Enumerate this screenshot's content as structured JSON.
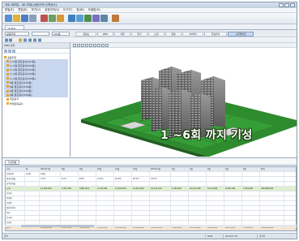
{
  "window": {
    "title": "지트 제작업 - 3D 모델 [공동주택 신축공사]"
  },
  "menu": [
    "파일(F)",
    "편집(E)",
    "보기(V)",
    "공정관리(S)",
    "도구(T)",
    "창(W)",
    "도움말(H)"
  ],
  "toolbar": {
    "icons": [
      {
        "name": "new-icon",
        "color": "#5a8fd0"
      },
      {
        "name": "open-icon",
        "color": "#e0b23c"
      },
      {
        "name": "save-icon",
        "color": "#4d7fc4"
      },
      {
        "name": "print-icon",
        "color": "#8aa0b8"
      },
      {
        "name": "cut-icon",
        "color": "#c05050"
      },
      {
        "name": "copy-icon",
        "color": "#6aa060"
      },
      {
        "name": "paste-icon",
        "color": "#d49a3a"
      },
      {
        "name": "schedule-icon",
        "color": "#3d7fbf"
      },
      {
        "name": "gantt-icon",
        "color": "#5a9fd0"
      },
      {
        "name": "model-icon",
        "color": "#4f8f4f"
      },
      {
        "name": "simulate-icon",
        "color": "#7a6fc0"
      },
      {
        "name": "report-icon",
        "color": "#5e86a8"
      },
      {
        "name": "chart-icon",
        "color": "#c07a3c"
      }
    ]
  },
  "document_tab": "3D뷰어",
  "filter": {
    "combo1": "공동주택",
    "combo2": "",
    "combo3": "101동"
  },
  "view_tabs": [
    "공정표",
    "WBS",
    "자원",
    "원가",
    "도면",
    "물량",
    "3D뷰어",
    "일정관리",
    "시뮬레이션"
  ],
  "active_view_tab": 8,
  "sidebar": {
    "header": "WBS 트리",
    "items": [
      {
        "label": "공동주택",
        "level": 0,
        "selected": false
      },
      {
        "label": "1~5층 골조공사(101동)",
        "level": 1,
        "selected": true
      },
      {
        "label": "1~5층 골조공사(102동)",
        "level": 1,
        "selected": true
      },
      {
        "label": "1~5층 골조공사(103동)",
        "level": 1,
        "selected": true
      },
      {
        "label": "1~5층 골조공사(104동)",
        "level": 1,
        "selected": true
      },
      {
        "label": "1~5층 골조공사(105동)",
        "level": 1,
        "selected": true
      },
      {
        "label": "6층 골조공사(101동)",
        "level": 1,
        "selected": true
      },
      {
        "label": "6층 골조공사(102동)",
        "level": 1,
        "selected": true
      },
      {
        "label": "6층 골조공사(103동)",
        "level": 1,
        "selected": true
      },
      {
        "label": "6층 골조공사(104동)",
        "level": 1,
        "selected": true
      },
      {
        "label": "마감공사",
        "level": 1,
        "selected": false
      },
      {
        "label": "부대토목공사",
        "level": 1,
        "selected": false
      }
    ]
  },
  "viewport": {
    "caption": "1 ~6회 까지 기성"
  },
  "bottom_panel": {
    "tab": "기성현황",
    "columns": [
      "구분",
      "명",
      "2014년7월",
      "8월",
      "9월",
      "10월",
      "11월",
      "12월",
      "2015년1월",
      "2월",
      "3월",
      "4월",
      "5월",
      "6월",
      "합계"
    ],
    "rows": [
      [
        "공정회차",
        "1회차",
        "2회차",
        "",
        "",
        "",
        "",
        "",
        "",
        "",
        "",
        "",
        "",
        "",
        ""
      ],
      [
        "계획공정율",
        "",
        "3.5%",
        "6.1%",
        "8.9%",
        "12.4%",
        "16.0%",
        "20.1%",
        "24.3%",
        "",
        "",
        "",
        "",
        "",
        ""
      ],
      [
        "실적공정율",
        "",
        "",
        "",
        "",
        "",
        "",
        "",
        "",
        "",
        "",
        "",
        "",
        "",
        ""
      ],
      [
        "소계",
        "",
        "11,365,250",
        "2,351,330",
        "3,887,614",
        "2,119,336",
        "11,300,100",
        "21,811,000",
        "19,311,214",
        "5,160,020",
        "10,231,400",
        "8,112,500",
        "6,205,330",
        "7,003,000",
        "108,858,094"
      ],
      [
        "공사비",
        "",
        "",
        "",
        "",
        "",
        "",
        "",
        "",
        "",
        "",
        "",
        "",
        "",
        ""
      ],
      [
        "직접비",
        "",
        "",
        "",
        "",
        "",
        "",
        "",
        "",
        "",
        "",
        "",
        "",
        "",
        ""
      ],
      [
        "간접비",
        "",
        "",
        "",
        "",
        "",
        "",
        "",
        "",
        "",
        "",
        "",
        "",
        "",
        ""
      ],
      [
        "일반관리비",
        "",
        "",
        "",
        "",
        "",
        "",
        "",
        "",
        "",
        "",
        "",
        "",
        "",
        ""
      ],
      [
        "이윤",
        "",
        "",
        "",
        "",
        "",
        "",
        "",
        "",
        "",
        "",
        "",
        "",
        "",
        ""
      ],
      [
        "부가세",
        "",
        "",
        "",
        "",
        "",
        "",
        "",
        "",
        "",
        "",
        "",
        "",
        "",
        ""
      ],
      [
        "보험료",
        "",
        "",
        "",
        "",
        "",
        "",
        "",
        "",
        "",
        "",
        "",
        "",
        "",
        ""
      ],
      [
        "합계",
        "",
        "11,365,250",
        "2,351,330",
        "3,887,614",
        "2,119,336",
        "11,300,100",
        "21,811,000",
        "19,311,214",
        "5,160,020",
        "10,231,400",
        "8,112,500",
        "6,205,330",
        "7,003,000",
        "108,858,094"
      ]
    ],
    "highlight_rows": {
      "3": "#dfeecf",
      "11": "#fbe4c9"
    }
  },
  "status": [
    "준비",
    "NUM",
    "2014-07-01",
    "관리자"
  ]
}
